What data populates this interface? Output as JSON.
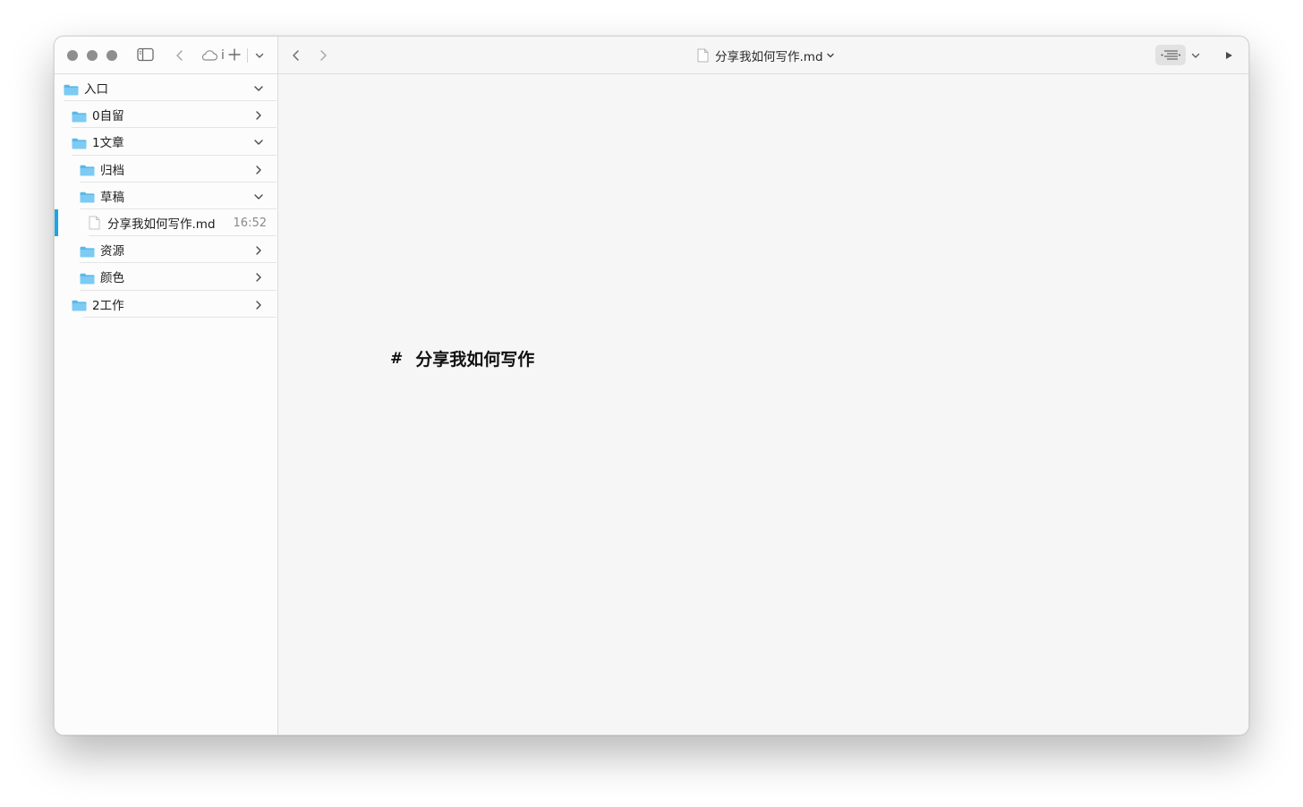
{
  "window": {
    "title": "分享我如何写作.md"
  },
  "sidebar": {
    "toolbar": {
      "icons": [
        "sidebar-toggle-icon",
        "back-icon",
        "icloud-icon",
        "info-icon",
        "new-icon",
        "chevron-down-icon"
      ],
      "icloud_text": "i"
    },
    "tree": [
      {
        "label": "入口",
        "type": "folder",
        "expanded": true
      },
      {
        "label": "0自留",
        "type": "folder",
        "expanded": false
      },
      {
        "label": "1文章",
        "type": "folder",
        "expanded": true
      },
      {
        "label": "归档",
        "type": "folder",
        "expanded": false
      },
      {
        "label": "草稿",
        "type": "folder",
        "expanded": true
      },
      {
        "label": "分享我如何写作.md",
        "type": "file",
        "time": "16:52",
        "selected": true
      },
      {
        "label": "资源",
        "type": "folder",
        "expanded": false
      },
      {
        "label": "颜色",
        "type": "folder",
        "expanded": false
      },
      {
        "label": "2工作",
        "type": "folder",
        "expanded": false
      }
    ]
  },
  "main": {
    "toolbar": {
      "doc_title": "分享我如何写作.md",
      "icons": [
        "back-icon",
        "forward-icon",
        "outline-icon",
        "chevron-down-icon",
        "play-icon"
      ]
    },
    "editor": {
      "heading_marker": "#",
      "heading_text": "分享我如何写作"
    }
  },
  "colors": {
    "accent": "#1aa6e4",
    "folder": "#5ab8ea"
  }
}
